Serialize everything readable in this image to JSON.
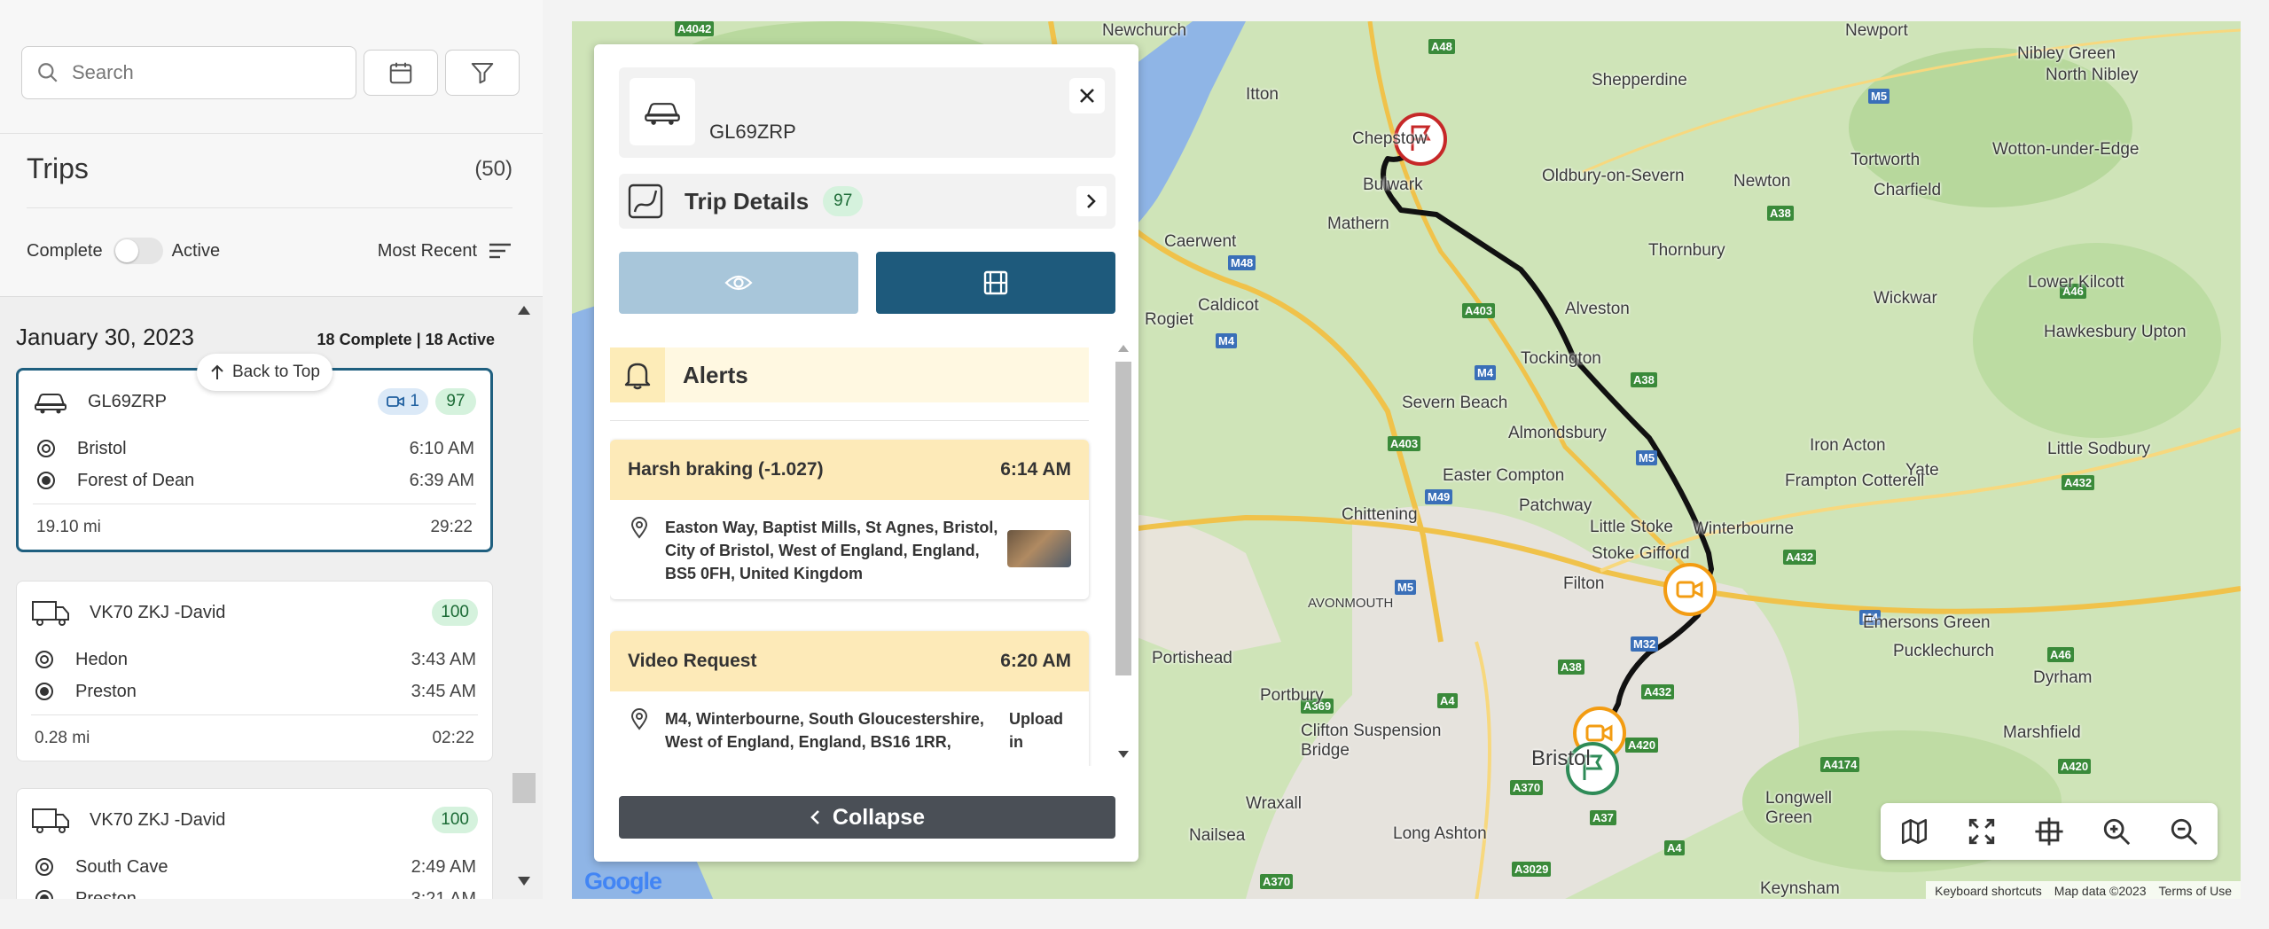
{
  "search": {
    "placeholder": "Search"
  },
  "trips": {
    "title": "Trips",
    "count": "(50)"
  },
  "filters": {
    "complete_label": "Complete",
    "active_label": "Active",
    "sort_label": "Most Recent"
  },
  "list": {
    "date": "January 30, 2023",
    "summary": "18 Complete | 18 Active",
    "back_to_top": "Back to Top",
    "cards": [
      {
        "vehicle": "GL69ZRP",
        "videos": "1",
        "score": "97",
        "from": "Bristol",
        "from_time": "6:10 AM",
        "to": "Forest of Dean",
        "to_time": "6:39 AM",
        "distance": "19.10 mi",
        "duration": "29:22"
      },
      {
        "vehicle": "VK70 ZKJ -David",
        "score": "100",
        "from": "Hedon",
        "from_time": "3:43 AM",
        "to": "Preston",
        "to_time": "3:45 AM",
        "distance": "0.28 mi",
        "duration": "02:22"
      },
      {
        "vehicle": "VK70 ZKJ -David",
        "score": "100",
        "from": "South Cave",
        "from_time": "2:49 AM",
        "to": "Preston",
        "to_time": "3:21 AM"
      }
    ]
  },
  "detail": {
    "vehicle": "GL69ZRP",
    "trip_details_label": "Trip Details",
    "score": "97",
    "alerts_title": "Alerts",
    "alerts": [
      {
        "title": "Harsh braking (-1.027)",
        "time": "6:14 AM",
        "address": "Easton Way, Baptist Mills, St Agnes, Bristol, City of Bristol, West of England, England, BS5 0FH, United Kingdom"
      },
      {
        "title": "Video Request",
        "time": "6:20 AM",
        "address": "M4, Winterbourne, South Gloucestershire, West of England, England, BS16 1RR,",
        "status": "Upload in"
      }
    ],
    "collapse_label": "Collapse"
  },
  "map": {
    "towns": [
      "Newchurch",
      "Itton",
      "Shepperdine",
      "Nibley Green",
      "North Nibley",
      "Newport",
      "Wotton-under-Edge",
      "Tortworth",
      "Charfield",
      "Chepstow",
      "Bulwark",
      "Mathern",
      "Oldbury-on-Severn",
      "Newton",
      "Caerwent",
      "Thornbury",
      "Wickwar",
      "Lower Kilcott",
      "Rogiet",
      "Caldicot",
      "Alveston",
      "Hawkesbury Upton",
      "Tockington",
      "Severn Beach",
      "Almondsbury",
      "Iron Acton",
      "Yate",
      "Little Sodbury",
      "Frampton Cotterell",
      "Easter Compton",
      "Patchway",
      "Chittening",
      "Little Stoke",
      "Winterbourne",
      "Stoke Gifford",
      "Filton",
      "Emersons Green",
      "Pucklechurch",
      "Dyrham",
      "Portishead",
      "Portbury",
      "Clifton Suspension Bridge",
      "Bristol",
      "Marshfield",
      "Wraxall",
      "Nailsea",
      "Long Ashton",
      "Longwell Green",
      "Keynsham",
      "AVONMOUTH"
    ],
    "roads": [
      "A4042",
      "A48",
      "M5",
      "A38",
      "M48",
      "A403",
      "M4",
      "M49",
      "A432",
      "A46",
      "A4174",
      "A420",
      "A369",
      "A4",
      "A370",
      "A37",
      "A3029",
      "M32"
    ],
    "footer": [
      "Keyboard shortcuts",
      "Map data ©2023",
      "Terms of Use"
    ],
    "logo": "Google",
    "colors": {
      "water": "#8fb5e6",
      "land": "#cfe4b8",
      "route": "#111111",
      "start": "#2e8b57",
      "end": "#c62828",
      "event": "#f39c12"
    }
  },
  "colors": {
    "selected_border": "#1f5f7f",
    "score_bg": "#d5f2dd",
    "alert_bg": "#fdeab8",
    "primary_dark": "#1e5a7c"
  }
}
